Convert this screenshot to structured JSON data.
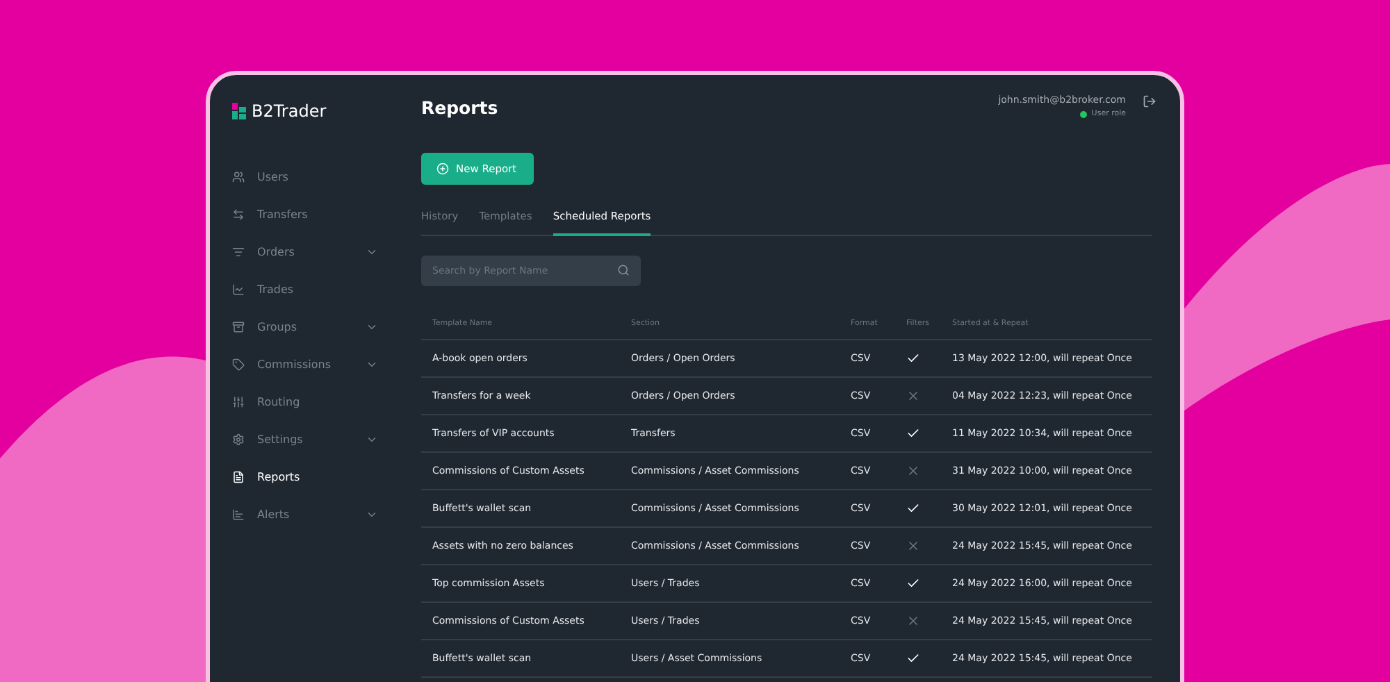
{
  "brand": "B2Trader",
  "sidebar": {
    "items": [
      {
        "label": "Users",
        "selected": false,
        "expandable": false
      },
      {
        "label": "Transfers",
        "selected": false,
        "expandable": false
      },
      {
        "label": "Orders",
        "selected": false,
        "expandable": true
      },
      {
        "label": "Trades",
        "selected": false,
        "expandable": false
      },
      {
        "label": "Groups",
        "selected": false,
        "expandable": true
      },
      {
        "label": "Commissions",
        "selected": false,
        "expandable": true
      },
      {
        "label": "Routing",
        "selected": false,
        "expandable": false
      },
      {
        "label": "Settings",
        "selected": false,
        "expandable": true
      },
      {
        "label": "Reports",
        "selected": true,
        "expandable": false
      },
      {
        "label": "Alerts",
        "selected": false,
        "expandable": true
      }
    ]
  },
  "page_title": "Reports",
  "user": {
    "email": "john.smith@b2broker.com",
    "role": "User role",
    "online": true
  },
  "new_button": "New Report",
  "tabs": [
    {
      "label": "History",
      "selected": false
    },
    {
      "label": "Templates",
      "selected": false
    },
    {
      "label": "Scheduled Reports",
      "selected": true
    }
  ],
  "search": {
    "placeholder": "Search by Report Name"
  },
  "table": {
    "columns": [
      "Template Name",
      "Section",
      "Format",
      "Filters",
      "Started at & Repeat"
    ],
    "rows": [
      {
        "name": "A-book open orders",
        "section": "Orders / Open Orders",
        "format": "CSV",
        "filters": true,
        "schedule": "13 May 2022 12:00, will repeat Once"
      },
      {
        "name": "Transfers for a week",
        "section": "Orders / Open Orders",
        "format": "CSV",
        "filters": false,
        "schedule": "04 May 2022 12:23, will repeat Once"
      },
      {
        "name": "Transfers of VIP accounts",
        "section": "Transfers",
        "format": "CSV",
        "filters": true,
        "schedule": "11 May 2022 10:34, will repeat Once"
      },
      {
        "name": "Commissions of Custom Assets",
        "section": "Commissions / Asset Commissions",
        "format": "CSV",
        "filters": false,
        "schedule": "31 May 2022 10:00, will repeat Once"
      },
      {
        "name": "Buffett's wallet scan",
        "section": "Commissions / Asset Commissions",
        "format": "CSV",
        "filters": true,
        "schedule": "30 May 2022 12:01, will repeat Once"
      },
      {
        "name": "Assets with no zero balances",
        "section": "Commissions / Asset Commissions",
        "format": "CSV",
        "filters": false,
        "schedule": "24 May 2022 15:45, will repeat Once"
      },
      {
        "name": "Top commission Assets",
        "section": "Users / Trades",
        "format": "CSV",
        "filters": true,
        "schedule": "24 May 2022 16:00, will repeat Once"
      },
      {
        "name": "Commissions of Custom Assets",
        "section": "Users / Trades",
        "format": "CSV",
        "filters": false,
        "schedule": "24 May 2022 15:45, will repeat Once"
      },
      {
        "name": "Buffett's wallet scan",
        "section": "Users / Asset Commissions",
        "format": "CSV",
        "filters": true,
        "schedule": "24 May 2022 15:45, will repeat Once"
      }
    ]
  }
}
